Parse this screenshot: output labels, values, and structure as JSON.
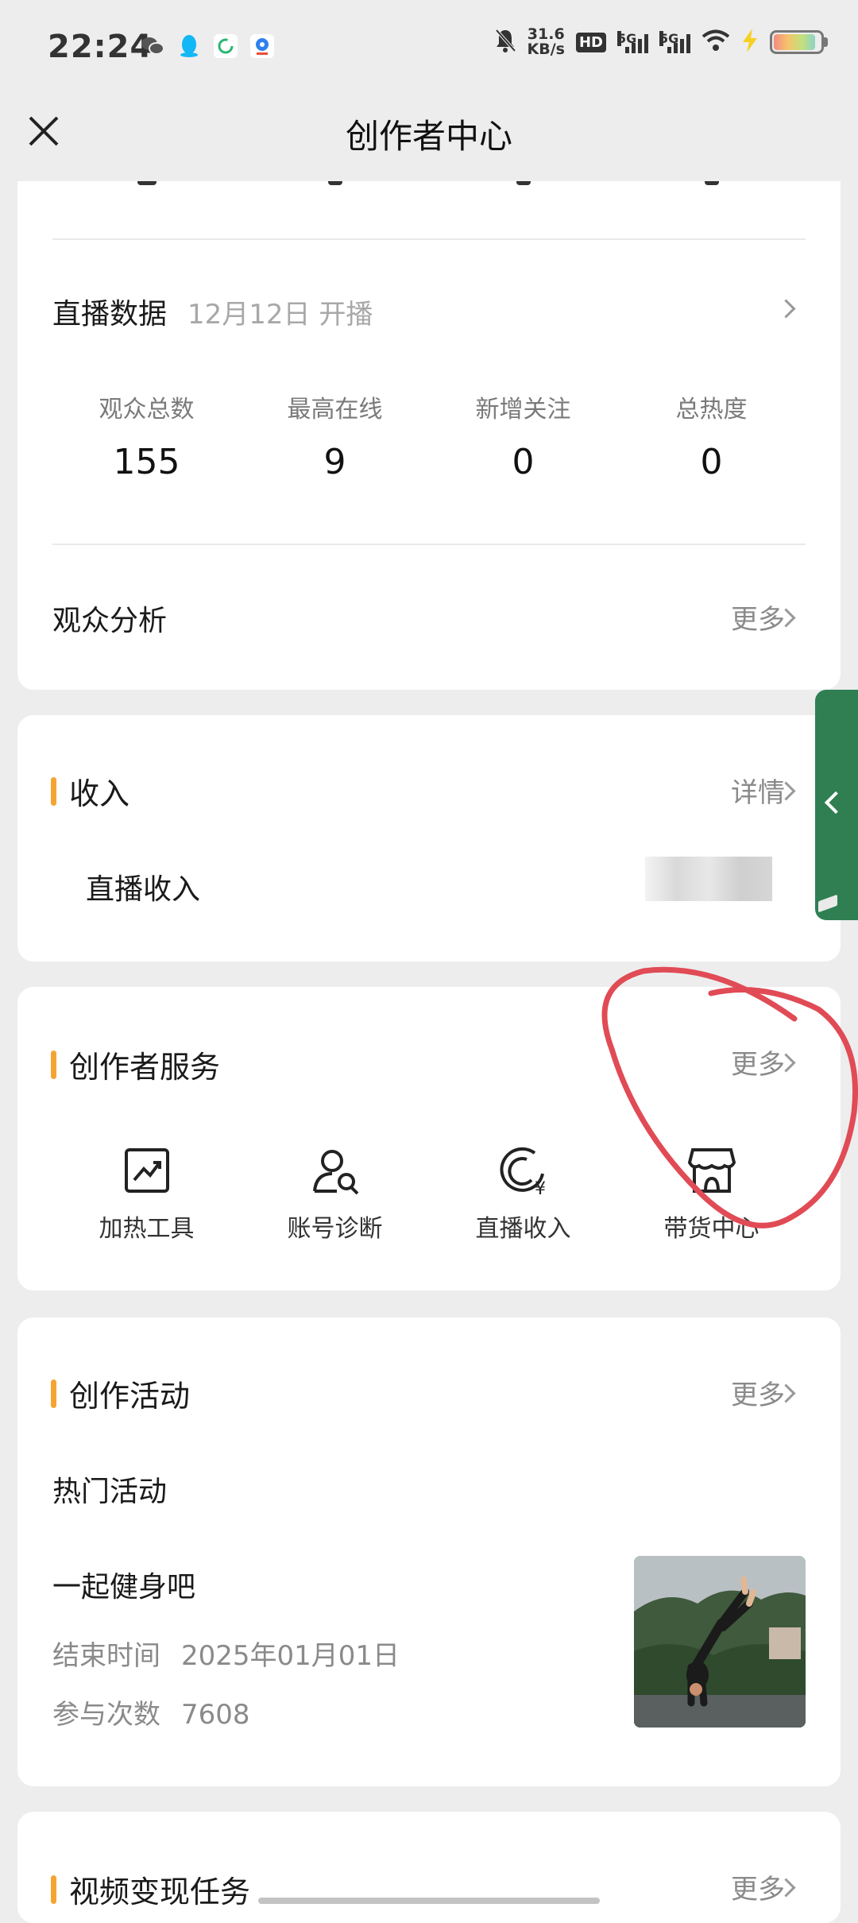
{
  "status_bar": {
    "time": "22:24",
    "net_speed_value": "31.6",
    "net_speed_unit": "KB/s",
    "hd_badge": "HD",
    "signal_1_label": "5G",
    "signal_2_label": "5G",
    "battery_level": 0.9
  },
  "nav": {
    "title": "创作者中心",
    "close_icon": "close-icon"
  },
  "live_data": {
    "title": "直播数据",
    "date": "12月12日 开播",
    "stats": [
      {
        "label": "观众总数",
        "value": "155"
      },
      {
        "label": "最高在线",
        "value": "9"
      },
      {
        "label": "新增关注",
        "value": "0"
      },
      {
        "label": "总热度",
        "value": "0"
      }
    ],
    "audience_title": "观众分析",
    "audience_more": "更多"
  },
  "income": {
    "title": "收入",
    "detail": "详情",
    "item_label": "直播收入"
  },
  "services": {
    "title": "创作者服务",
    "more": "更多",
    "items": [
      {
        "label": "加热工具",
        "icon": "chart-trend-icon"
      },
      {
        "label": "账号诊断",
        "icon": "user-search-icon"
      },
      {
        "label": "直播收入",
        "icon": "yuan-income-icon"
      },
      {
        "label": "带货中心",
        "icon": "shop-icon"
      }
    ]
  },
  "activities": {
    "title": "创作活动",
    "more": "更多",
    "hot_title": "热门活动",
    "activity_name": "一起健身吧",
    "end_label": "结束时间",
    "end_value": "2025年01月01日",
    "count_label": "参与次数",
    "count_value": "7608"
  },
  "video_tasks": {
    "title": "视频变现任务",
    "more": "更多"
  },
  "colors": {
    "accent": "#f5a431",
    "side_tab": "#2f7f52",
    "annotation": "#e04b55"
  }
}
